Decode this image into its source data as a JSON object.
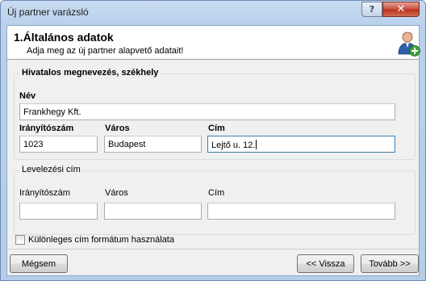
{
  "window": {
    "title": "Új partner varázsló",
    "help_label": "?",
    "close_label": "✕"
  },
  "header": {
    "title": "1.Általános adatok",
    "subtitle": "Adja meg az új partner alapvető adatait!",
    "icon": "user-add-icon"
  },
  "official": {
    "legend": "Hivatalos megnevezés, székhely",
    "name_label": "Név",
    "name_value": "Frankhegy Kft.",
    "zip_label": "Irányítószám",
    "zip_value": "1023",
    "city_label": "Város",
    "city_value": "Budapest",
    "address_label": "Cím",
    "address_value": "Lejtő u. 12."
  },
  "mailing": {
    "legend": "Levelezési cím",
    "zip_label": "Irányítószám",
    "zip_value": "",
    "city_label": "Város",
    "city_value": "",
    "address_label": "Cím",
    "address_value": ""
  },
  "special_format": {
    "label": "Különleges cím formátum használata",
    "checked": false
  },
  "buttons": {
    "cancel": "Mégsem",
    "back": "<< Vissza",
    "next": "Tovább >>"
  },
  "colors": {
    "close_button": "#c9503e",
    "title_bar": "#b9d1ec",
    "focus_border": "#3c7fb1"
  }
}
